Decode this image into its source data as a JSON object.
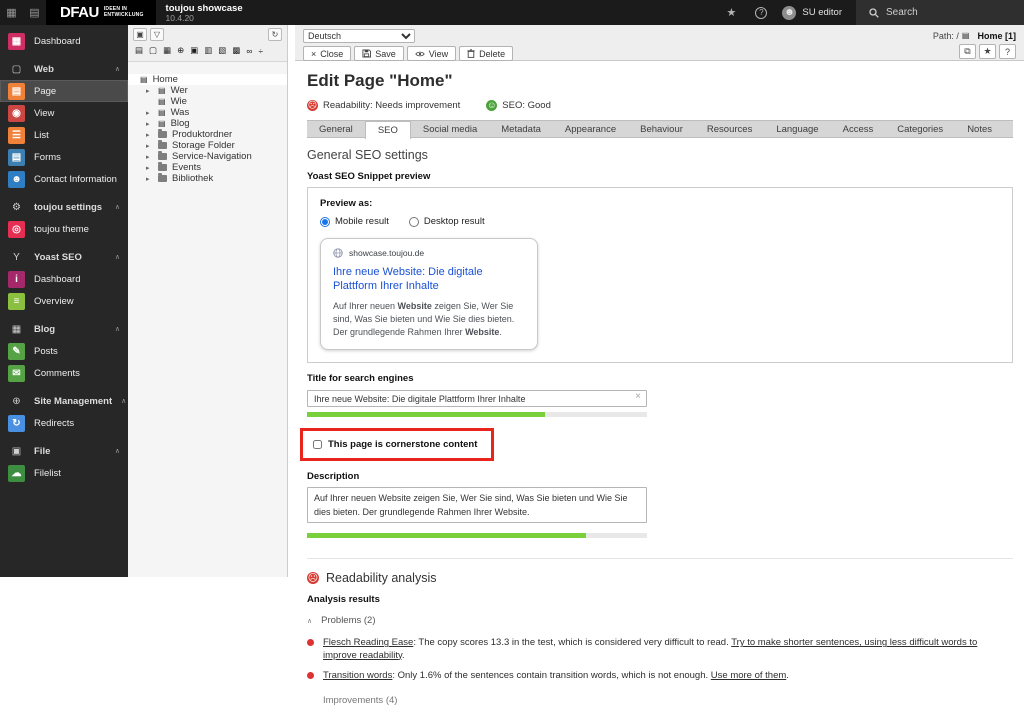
{
  "colors": {
    "accent_green": "#7ad03a",
    "status_red": "#dc3232",
    "status_green": "#4ca33c",
    "snippet_link_blue": "#1b51d4",
    "annotation_red": "#e8241c"
  },
  "topbar": {
    "logo": "DFAU",
    "logo_sub1": "IDEEN IN",
    "logo_sub2": "ENTWICKLUNG",
    "site_name": "toujou showcase",
    "site_version": "10.4.20",
    "user": "SU editor",
    "search_label": "Search"
  },
  "module_menu": {
    "rows": [
      {
        "type": "item",
        "label": "Dashboard",
        "glyph": "▦",
        "color": "#cf2e64"
      },
      {
        "type": "header",
        "label": "Web",
        "glyph": "▢"
      },
      {
        "type": "item",
        "label": "Page",
        "glyph": "▤",
        "color": "#ef8138"
      },
      {
        "type": "item",
        "label": "View",
        "glyph": "◉",
        "color": "#cc4744"
      },
      {
        "type": "item",
        "label": "List",
        "glyph": "☰",
        "color": "#ef8138"
      },
      {
        "type": "item",
        "label": "Forms",
        "glyph": "▤",
        "color": "#3e7fb2"
      },
      {
        "type": "item",
        "label": "Contact Information",
        "glyph": "☻",
        "color": "#2f7ec4"
      },
      {
        "type": "header",
        "label": "toujou settings",
        "glyph": "⚙"
      },
      {
        "type": "item",
        "label": "toujou theme",
        "glyph": "◎",
        "color": "#e62e52"
      },
      {
        "type": "header",
        "label": "Yoast SEO",
        "glyph": "Y"
      },
      {
        "type": "item",
        "label": "Dashboard",
        "glyph": "i",
        "color": "#a4286a"
      },
      {
        "type": "item",
        "label": "Overview",
        "glyph": "≡",
        "color": "#8bbf3f"
      },
      {
        "type": "header",
        "label": "Blog",
        "glyph": "▦"
      },
      {
        "type": "item",
        "label": "Posts",
        "glyph": "✎",
        "color": "#56a345"
      },
      {
        "type": "item",
        "label": "Comments",
        "glyph": "✉",
        "color": "#56a345"
      },
      {
        "type": "header",
        "label": "Site Management",
        "glyph": "⊕"
      },
      {
        "type": "item",
        "label": "Redirects",
        "glyph": "↻",
        "color": "#4a90e2"
      },
      {
        "type": "header",
        "label": "File",
        "glyph": "▣"
      },
      {
        "type": "item",
        "label": "Filelist",
        "glyph": "☁",
        "color": "#3e8e41"
      }
    ]
  },
  "pagetree": {
    "toolbar_icons": [
      "▤",
      "▢",
      "▦",
      "⊕",
      "▣",
      "▥",
      "▧",
      "▩",
      "∞",
      "÷"
    ],
    "filter_icon": "▽",
    "new_icon": "▣",
    "refresh_icon": "↻",
    "nodes": [
      {
        "label": "Home"
      },
      {
        "label": "Wer"
      },
      {
        "label": "Wie"
      },
      {
        "label": "Was"
      },
      {
        "label": "Blog"
      },
      {
        "label": "Produktordner"
      },
      {
        "label": "Storage Folder"
      },
      {
        "label": "Service-Navigation"
      },
      {
        "label": "Events"
      },
      {
        "label": "Bibliothek"
      }
    ]
  },
  "docheader": {
    "language": "Deutsch",
    "path_label": "Path: /",
    "path_page": "Home [1]",
    "buttons": {
      "close": "Close",
      "save": "Save",
      "view": "View",
      "delete": "Delete"
    }
  },
  "content": {
    "title": "Edit Page \"Home\"",
    "readability_badge": "Readability: Needs improvement",
    "seo_badge": "SEO: Good",
    "tabs": [
      "General",
      "SEO",
      "Social media",
      "Metadata",
      "Appearance",
      "Behaviour",
      "Resources",
      "Language",
      "Access",
      "Categories",
      "Notes"
    ],
    "section_title": "General SEO settings",
    "snippet": {
      "label": "Yoast SEO Snippet preview",
      "preview_as": "Preview as:",
      "mobile": "Mobile result",
      "desktop": "Desktop result",
      "url": "showcase.toujou.de",
      "title": "Ihre neue Website: Die digitale Plattform Ihrer Inhalte",
      "desc_parts": [
        "Auf Ihrer neuen ",
        "Website",
        " zeigen Sie, Wer Sie sind, Was Sie bieten und Wie Sie dies bieten. Der grundlegende Rahmen Ihrer ",
        "Website",
        "."
      ]
    },
    "title_field": {
      "label": "Title for search engines",
      "value": "Ihre neue Website: Die digitale Plattform Ihrer Inhalte",
      "progress": "70%"
    },
    "cornerstone": {
      "label": "This page is cornerstone content"
    },
    "description_field": {
      "label": "Description",
      "value": "Auf Ihrer neuen Website zeigen Sie, Wer Sie sind, Was Sie bieten und Wie Sie dies bieten. Der grundlegende Rahmen Ihrer Website.",
      "progress": "82%"
    },
    "readability": {
      "title": "Readability analysis",
      "subtitle": "Analysis results",
      "problems": "Problems (2)",
      "items": [
        {
          "link": "Flesch Reading Ease",
          "text": ": The copy scores 13.3 in the test, which is considered very difficult to read. ",
          "link2": "Try to make shorter sentences, using less difficult words to improve readability",
          "suffix": "."
        },
        {
          "link": "Transition words",
          "text": ": Only 1.6% of the sentences contain transition words, which is not enough. ",
          "link2": "Use more of them",
          "suffix": "."
        }
      ],
      "next_section": "Improvements (4)"
    }
  }
}
